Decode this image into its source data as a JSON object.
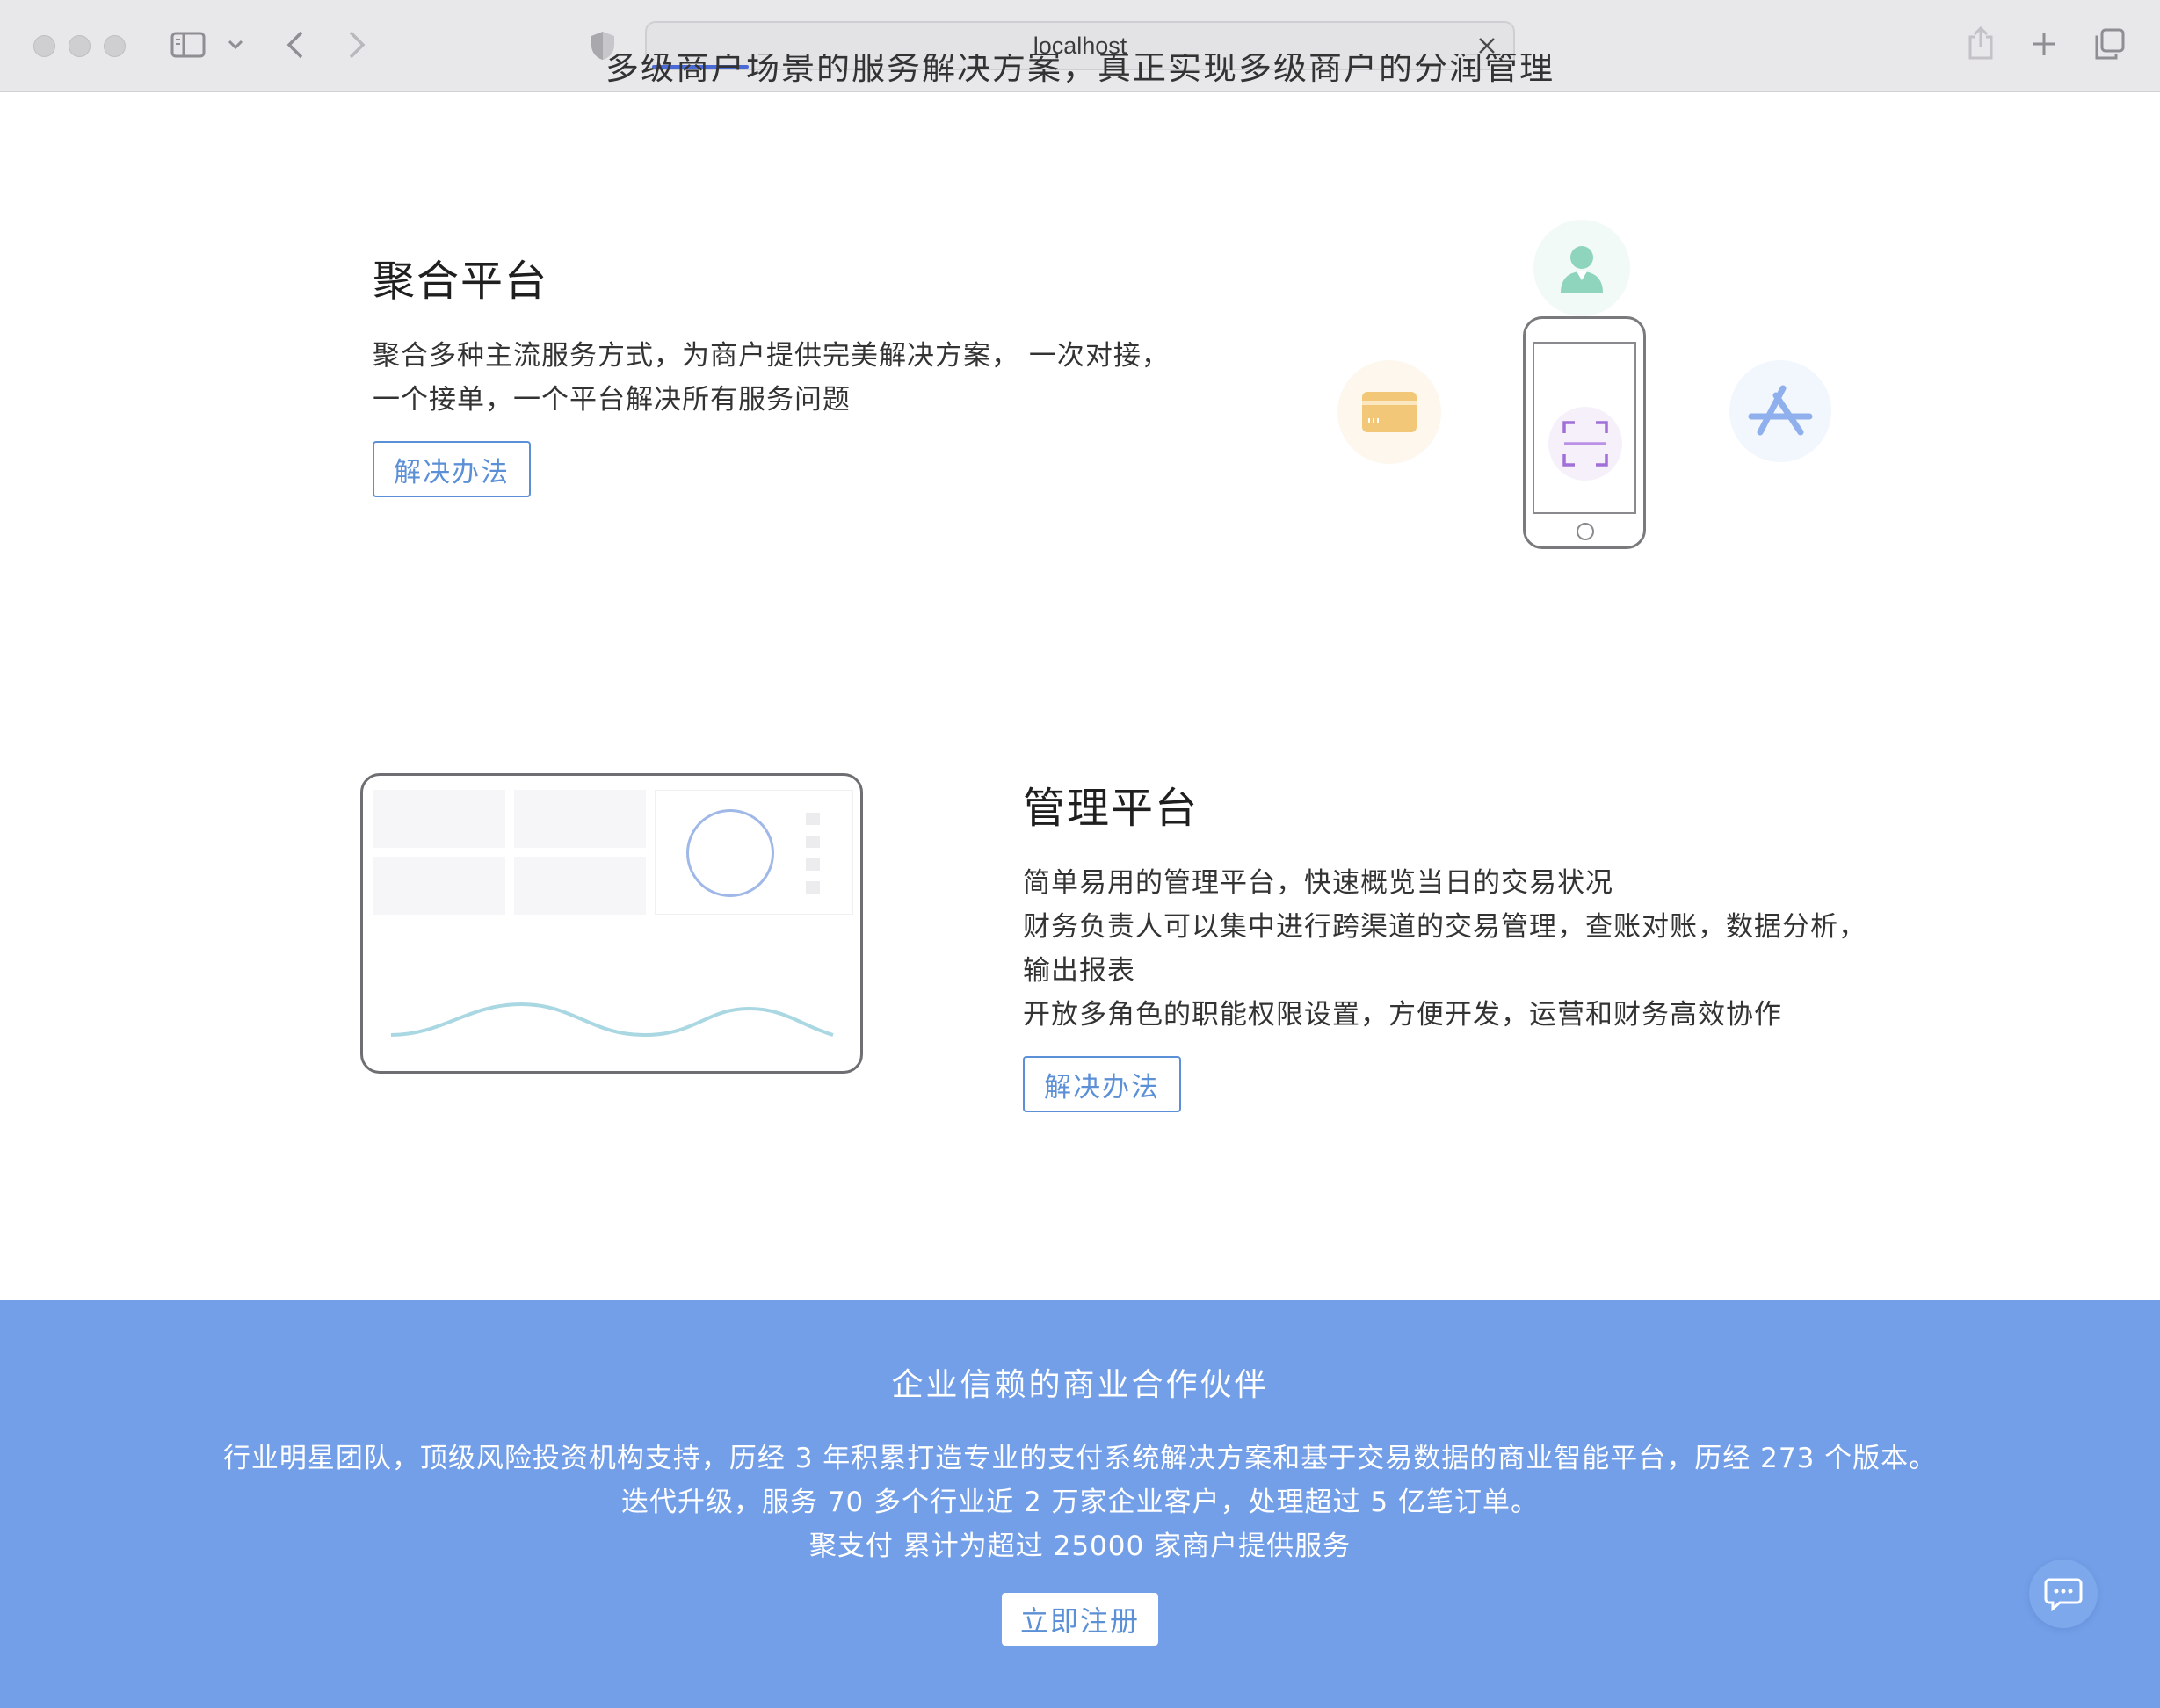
{
  "browser": {
    "url": "localhost",
    "icons": [
      "sidebar-icon",
      "chevron-down-icon",
      "back-icon",
      "forward-icon",
      "shield-icon",
      "close-icon",
      "share-icon",
      "plus-icon",
      "tabs-icon"
    ]
  },
  "hero": {
    "partial_subtitle": "多级商户场景的服务解决方案，真正实现多级商户的分润管理"
  },
  "features": [
    {
      "title": "聚合平台",
      "lines": [
        "聚合多种主流服务方式，为商户提供完美解决方案， 一次对接，",
        "一个接单，一个平台解决所有服务问题"
      ],
      "button": "解决办法",
      "illustration_icons": [
        "user-icon",
        "card-icon",
        "phone-icon",
        "scan-icon",
        "app-store-icon"
      ]
    },
    {
      "title": "管理平台",
      "lines": [
        "简单易用的管理平台，快速概览当日的交易状况",
        "财务负责人可以集中进行跨渠道的交易管理，查账对账，数据分析，",
        "输出报表",
        "开放多角色的职能权限设置，方便开发，运营和财务高效协作"
      ],
      "button": "解决办法",
      "illustration_icons": [
        "dashboard-icon"
      ]
    }
  ],
  "banner": {
    "title": "企业信赖的商业合作伙伴",
    "lines": [
      "行业明星团队，顶级风险投资机构支持，历经 3 年积累打造专业的支付系统解决方案和基于交易数据的商业智能平台，历经 273 个版本。",
      "迭代升级，服务 70 多个行业近 2 万家企业客户，处理超过 5 亿笔订单。",
      "聚支付 累计为超过 25000 家商户提供服务"
    ],
    "button": "立即注册",
    "background": "#739fe8"
  },
  "colors": {
    "accent": "#5b8fd6"
  }
}
